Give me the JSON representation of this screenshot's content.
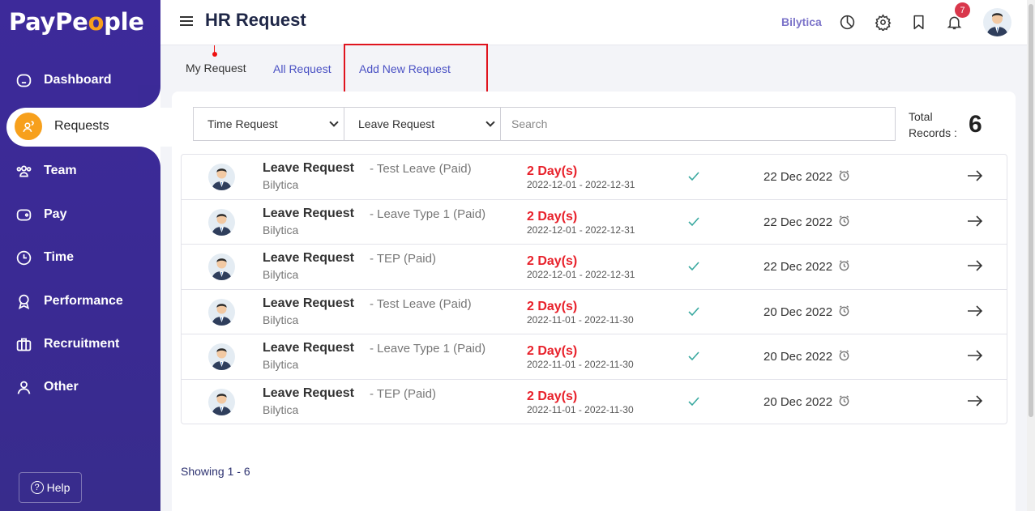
{
  "sidebar": {
    "logo_a": "PayPe",
    "logo_o": "o",
    "logo_b": "ple",
    "items": [
      {
        "label": "Dashboard",
        "icon": "home-icon"
      },
      {
        "label": "Requests",
        "icon": "requests-icon",
        "active": true
      },
      {
        "label": "Team",
        "icon": "team-icon"
      },
      {
        "label": "Pay",
        "icon": "wallet-icon"
      },
      {
        "label": "Time",
        "icon": "clock-icon"
      },
      {
        "label": "Performance",
        "icon": "award-icon"
      },
      {
        "label": "Recruitment",
        "icon": "briefcase-icon"
      },
      {
        "label": "Other",
        "icon": "user-icon"
      }
    ],
    "help_label": "Help",
    "help_icon_glyph": "?"
  },
  "header": {
    "title": "HR Request",
    "company": "Bilytica",
    "notification_count": "7"
  },
  "tabs": {
    "my": "My Request",
    "all": "All Request",
    "new": "Add New Request"
  },
  "filters": {
    "type_select": "Time Request",
    "request_select": "Leave Request",
    "search_placeholder": "Search",
    "total_label": "Total Records :",
    "total_value": "6"
  },
  "requests": [
    {
      "title": "Leave Request",
      "subtitle": "- Test Leave (Paid)",
      "company": "Bilytica",
      "days": "2 Day(s)",
      "range": "2022-12-01 - 2022-12-31",
      "date": "22 Dec 2022"
    },
    {
      "title": "Leave Request",
      "subtitle": "- Leave Type 1 (Paid)",
      "company": "Bilytica",
      "days": "2 Day(s)",
      "range": "2022-12-01 - 2022-12-31",
      "date": "22 Dec 2022"
    },
    {
      "title": "Leave Request",
      "subtitle": "- TEP (Paid)",
      "company": "Bilytica",
      "days": "2 Day(s)",
      "range": "2022-12-01 - 2022-12-31",
      "date": "22 Dec 2022"
    },
    {
      "title": "Leave Request",
      "subtitle": "- Test Leave (Paid)",
      "company": "Bilytica",
      "days": "2 Day(s)",
      "range": "2022-11-01 - 2022-11-30",
      "date": "20 Dec 2022"
    },
    {
      "title": "Leave Request",
      "subtitle": "- Leave Type 1 (Paid)",
      "company": "Bilytica",
      "days": "2 Day(s)",
      "range": "2022-11-01 - 2022-11-30",
      "date": "20 Dec 2022"
    },
    {
      "title": "Leave Request",
      "subtitle": "- TEP (Paid)",
      "company": "Bilytica",
      "days": "2 Day(s)",
      "range": "2022-11-01 - 2022-11-30",
      "date": "20 Dec 2022"
    }
  ],
  "footer": {
    "showing": "Showing 1 - 6"
  },
  "colors": {
    "sidebar": "#3d2a9a",
    "accent": "#f7a01c",
    "link": "#4a51c4",
    "danger": "#e8202a",
    "highlight": "#e0141e"
  }
}
